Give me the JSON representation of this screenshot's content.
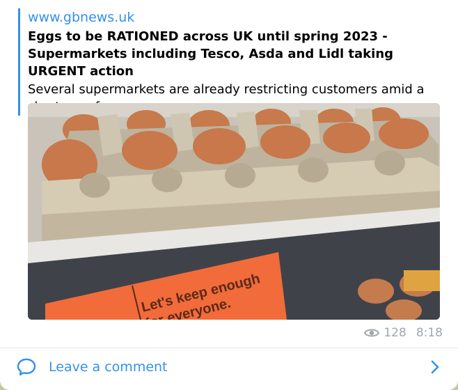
{
  "post": {
    "link_preview": {
      "site_name": "www.gbnews.uk",
      "title": "Eggs to be RATIONED across UK until spring 2023 - Supermarkets including Tesco, Asda and Lidl taking URGENT action",
      "description": "Several supermarkets are already restricting customers amid a shortage of eggs",
      "image": {
        "shelf_sign_line1": "Let's keep enough",
        "shelf_sign_line2": "for everyone."
      }
    },
    "views": "128",
    "time": "8:18"
  },
  "comments": {
    "label": "Leave a comment"
  },
  "colors": {
    "accent": "#3390ec",
    "meta": "#a0a7ad",
    "sign": "#f26b3a"
  }
}
